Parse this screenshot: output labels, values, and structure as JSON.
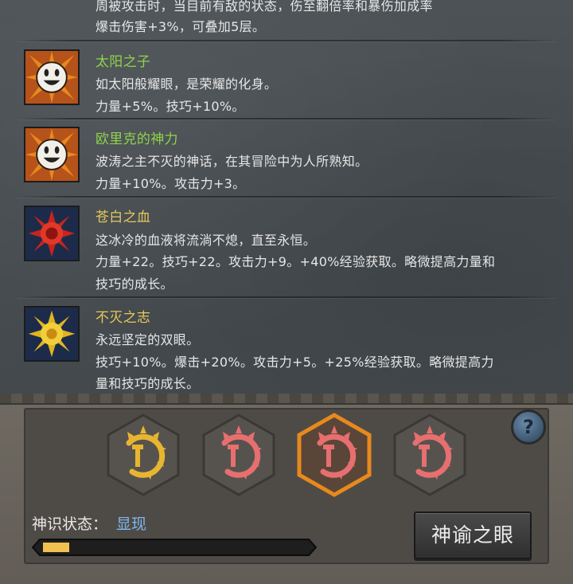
{
  "buffs": [
    {
      "id": "partial",
      "title": "",
      "lines": [
        "周被攻击时，当目前有敌的状态，伤至翻倍率和暴伤加成率",
        "爆击伤害+3%，可叠加5层。"
      ]
    },
    {
      "id": "sun-son",
      "title": "太阳之子",
      "title_color": "green",
      "icon": "smiley-sun-icon",
      "lines": [
        "如太阳般耀眼，是荣耀的化身。",
        "力量+5%。技巧+10%。"
      ]
    },
    {
      "id": "euric-power",
      "title": "欧里克的神力",
      "title_color": "green",
      "icon": "smiley-sun-icon",
      "lines": [
        "波涛之主不灭的神话，在其冒险中为人所熟知。",
        "力量+10%。攻击力+3。"
      ]
    },
    {
      "id": "pale-blood",
      "title": "苍白之血",
      "title_color": "yellow",
      "icon": "red-sun-icon",
      "lines": [
        "这冰冷的血液将流淌不熄，直至永恒。",
        "力量+22。技巧+22。攻击力+9。+40%经验获取。略微提高力量和",
        "技巧的成长。"
      ]
    },
    {
      "id": "immortal-will",
      "title": "不灭之志",
      "title_color": "yellow",
      "icon": "gold-sun-icon",
      "lines": [
        "永远坚定的双眼。",
        "技巧+10%。爆击+20%。攻击力+5。+25%经验获取。略微提高力",
        "量和技巧的成长。"
      ]
    }
  ],
  "glyphs": [
    {
      "name": "gold-glyph-icon",
      "color": "#e8b531",
      "selected": false
    },
    {
      "name": "red-glyph-icon",
      "color": "#e86f6f",
      "selected": false
    },
    {
      "name": "red-glyph-icon-selected",
      "color": "#e86f6f",
      "selected": true
    },
    {
      "name": "red-glyph-icon",
      "color": "#e86f6f",
      "selected": false
    }
  ],
  "status": {
    "label": "神识状态：",
    "value": "显现"
  },
  "progress": {
    "fraction": 0.1
  },
  "oracle_button": {
    "label": "神谕之眼"
  },
  "help": {
    "symbol": "?"
  },
  "colors": {
    "green_title": "#8fd34a",
    "yellow_title": "#e7c85a",
    "accent_orange": "#e7891e",
    "status_blue": "#7fb6ef"
  }
}
